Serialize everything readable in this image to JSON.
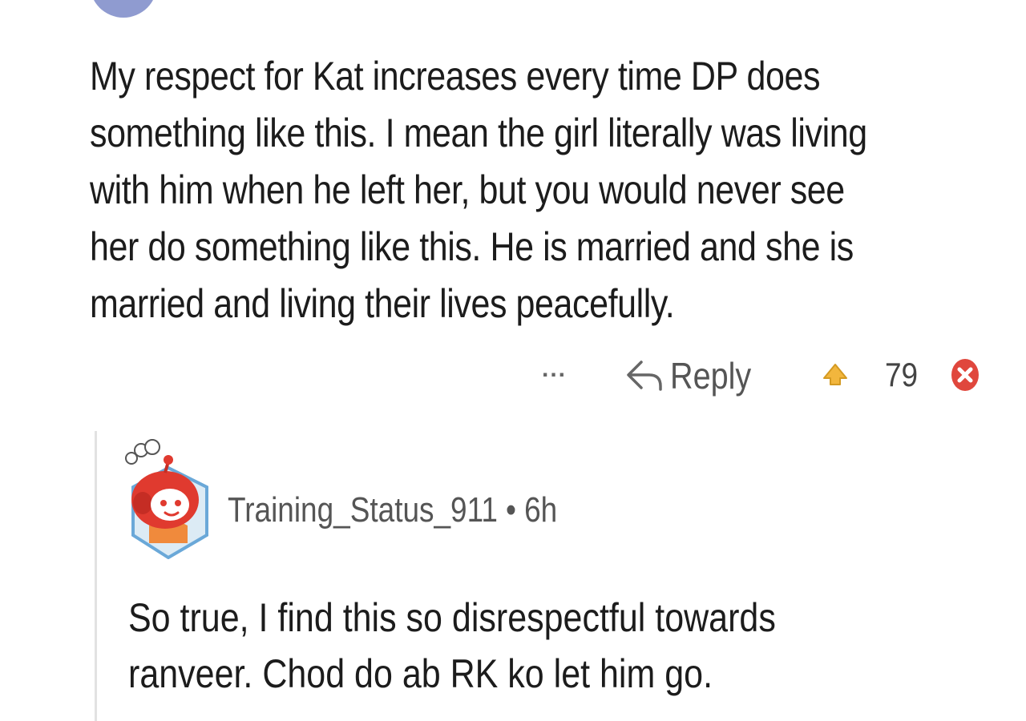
{
  "comment": {
    "body": "My respect for Kat increases every time DP does something like this. I mean the girl literally was living with him when he left her, but you would never see her do something like this. He is married and she is married and living their lives peacefully.",
    "actions": {
      "more_label": "...",
      "reply_label": "Reply",
      "vote_count": "79"
    }
  },
  "reply": {
    "username": "Training_Status_911",
    "separator": "•",
    "age": "6h",
    "body": "So true, I find this so disrespectful towards ranveer. Chod do ab RK ko let him go."
  },
  "icons": {
    "more": "more-options-icon",
    "reply": "reply-arrow-icon",
    "upvote": "upvote-icon",
    "downvote": "downvote-icon",
    "avatar": "snoo-avatar-icon"
  },
  "colors": {
    "upvote": "#f2b63d",
    "downvote": "#e0473d",
    "avatar_red": "#e03a2f",
    "text": "#1c1c1c",
    "meta_text": "#555555"
  }
}
